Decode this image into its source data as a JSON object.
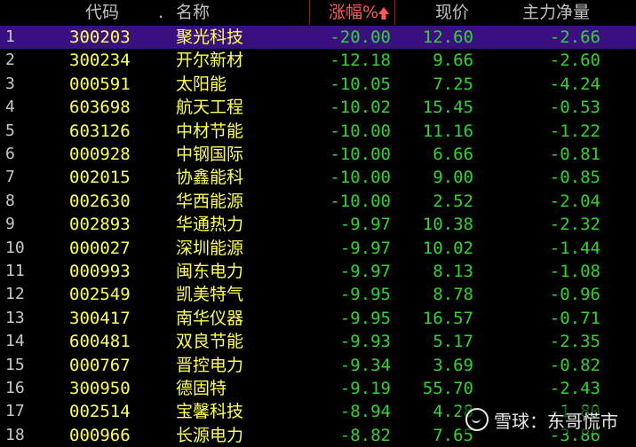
{
  "header": {
    "code": "代码",
    "dot": ".",
    "name": "名称",
    "change": "涨幅%",
    "sort_indicator": "sort-desc-up-arrow",
    "price": "现价",
    "net": "主力净量"
  },
  "rows": [
    {
      "idx": "1",
      "code": "300203",
      "name": "聚光科技",
      "change": "-20.00",
      "price": "12.60",
      "net": "-2.66"
    },
    {
      "idx": "2",
      "code": "300234",
      "name": "开尔新材",
      "change": "-12.18",
      "price": "9.66",
      "net": "-2.60"
    },
    {
      "idx": "3",
      "code": "000591",
      "name": "太阳能",
      "change": "-10.05",
      "price": "7.25",
      "net": "-4.24"
    },
    {
      "idx": "4",
      "code": "603698",
      "name": "航天工程",
      "change": "-10.02",
      "price": "15.45",
      "net": "-0.53"
    },
    {
      "idx": "5",
      "code": "603126",
      "name": "中材节能",
      "change": "-10.00",
      "price": "11.16",
      "net": "-1.22"
    },
    {
      "idx": "6",
      "code": "000928",
      "name": "中钢国际",
      "change": "-10.00",
      "price": "6.66",
      "net": "-0.81"
    },
    {
      "idx": "7",
      "code": "002015",
      "name": "协鑫能科",
      "change": "-10.00",
      "price": "9.00",
      "net": "-0.85"
    },
    {
      "idx": "8",
      "code": "002630",
      "name": "华西能源",
      "change": "-10.00",
      "price": "2.52",
      "net": "-2.04"
    },
    {
      "idx": "9",
      "code": "002893",
      "name": "华通热力",
      "change": "-9.97",
      "price": "10.38",
      "net": "-2.32"
    },
    {
      "idx": "10",
      "code": "000027",
      "name": "深圳能源",
      "change": "-9.97",
      "price": "10.02",
      "net": "-1.44"
    },
    {
      "idx": "11",
      "code": "000993",
      "name": "闽东电力",
      "change": "-9.97",
      "price": "8.13",
      "net": "-1.08"
    },
    {
      "idx": "12",
      "code": "002549",
      "name": "凯美特气",
      "change": "-9.95",
      "price": "8.78",
      "net": "-0.96"
    },
    {
      "idx": "13",
      "code": "300417",
      "name": "南华仪器",
      "change": "-9.95",
      "price": "16.57",
      "net": "-0.71"
    },
    {
      "idx": "14",
      "code": "600481",
      "name": "双良节能",
      "change": "-9.93",
      "price": "5.17",
      "net": "-2.35"
    },
    {
      "idx": "15",
      "code": "000767",
      "name": "晋控电力",
      "change": "-9.34",
      "price": "3.69",
      "net": "-0.82"
    },
    {
      "idx": "16",
      "code": "300950",
      "name": "德固特",
      "change": "-9.19",
      "price": "55.70",
      "net": "-2.43"
    },
    {
      "idx": "17",
      "code": "002514",
      "name": "宝馨科技",
      "change": "-8.94",
      "price": "4.28",
      "net": "-1.80"
    },
    {
      "idx": "18",
      "code": "000966",
      "name": "长源电力",
      "change": "-8.82",
      "price": "7.65",
      "net": "-3.86"
    }
  ],
  "selected_row": 0,
  "colors": {
    "background": "#000000",
    "selected_row": "#3a1080",
    "code_name": "#ffff55",
    "numbers_down": "#32d232",
    "header_text": "#c0c0c0",
    "sorted_header": "#ff5a5a"
  },
  "watermark": {
    "icon": "xueqiu-logo-icon",
    "text": "雪球：东哥慌市"
  }
}
